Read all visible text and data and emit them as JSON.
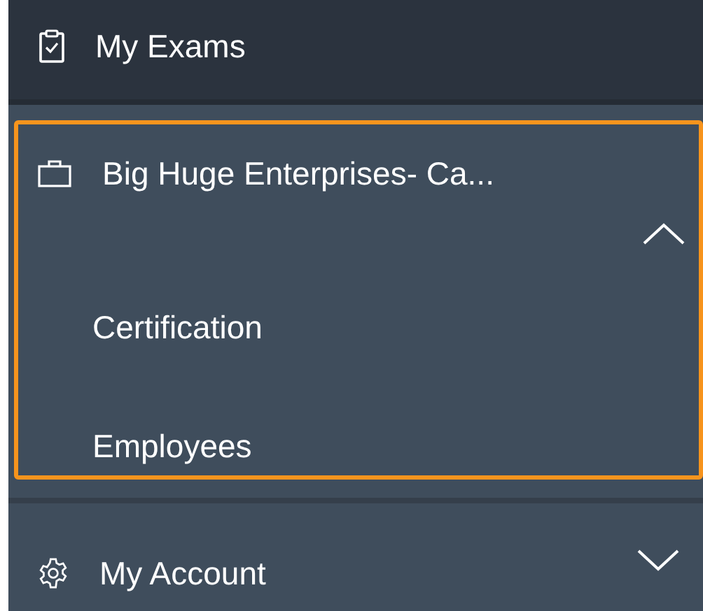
{
  "menu": [
    {
      "kind": "link",
      "label": "My Exams",
      "selected": true
    },
    {
      "kind": "group",
      "label": "Big Huge Enterprises- Ca...",
      "selected": false,
      "expanded": true,
      "focused": true,
      "children": [
        {
          "label": "Certification"
        },
        {
          "label": "Employees"
        }
      ]
    },
    {
      "kind": "group",
      "label": "My Account",
      "selected": false,
      "expanded": false,
      "focused": false
    }
  ]
}
